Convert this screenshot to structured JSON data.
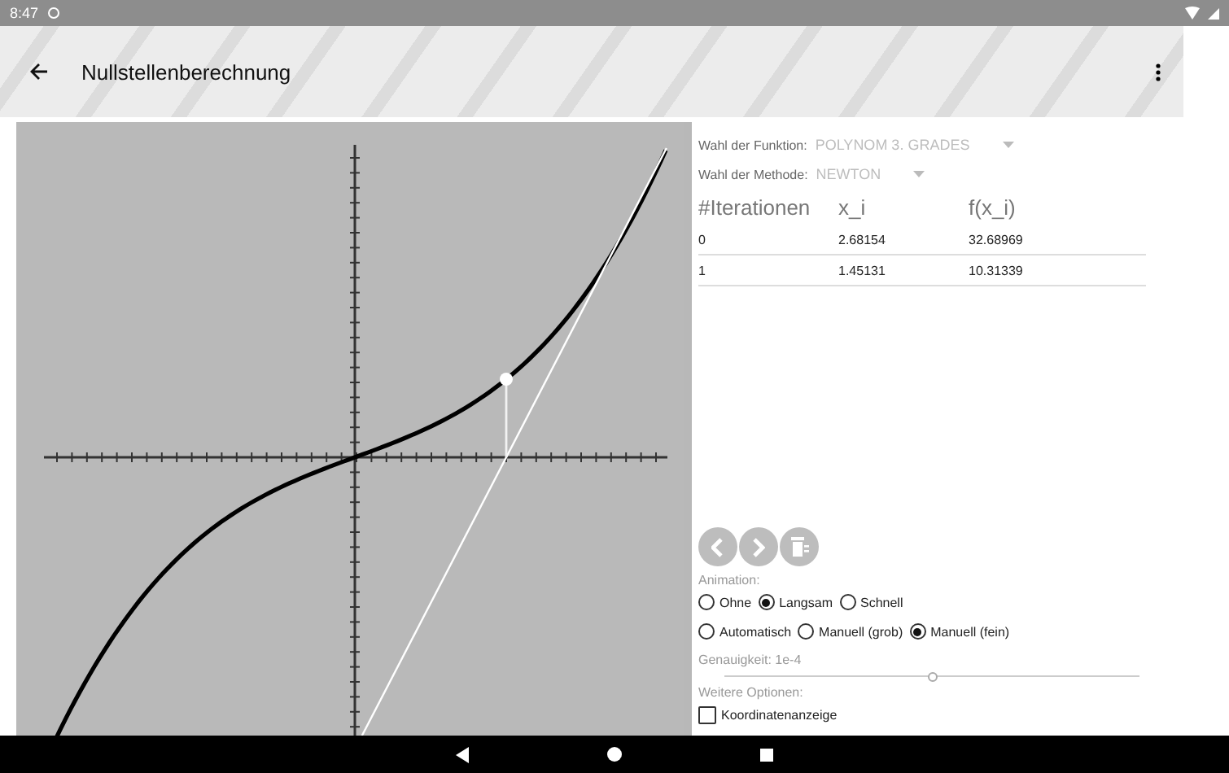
{
  "status_bar": {
    "time": "8:47"
  },
  "app_bar": {
    "title": "Nullstellenberechnung"
  },
  "settings": [
    {
      "label": "Wahl der Funktion:",
      "value": "POLYNOM 3. GRADES"
    },
    {
      "label": "Wahl der Methode:",
      "value": "NEWTON"
    }
  ],
  "table": {
    "columns": [
      "#Iterationen",
      "x_i",
      "f(x_i)"
    ],
    "rows": [
      [
        "0",
        "2.68154",
        "32.68969"
      ],
      [
        "1",
        "1.45131",
        "10.31339"
      ]
    ]
  },
  "step_buttons": [
    {
      "kind": "back"
    },
    {
      "kind": "forward"
    },
    {
      "kind": "delete"
    }
  ],
  "animation": {
    "label": "Animation:",
    "speed": [
      {
        "label": "Ohne",
        "selected": false
      },
      {
        "label": "Langsam",
        "selected": true
      },
      {
        "label": "Schnell",
        "selected": false
      }
    ],
    "mode": [
      {
        "label": "Automatisch",
        "selected": false
      },
      {
        "label": "Manuell (grob)",
        "selected": false
      },
      {
        "label": "Manuell (fein)",
        "selected": true
      }
    ]
  },
  "accuracy": {
    "label": "Genauigkeit: 1e-4",
    "level": 0.5
  },
  "options": {
    "label": "Weitere Optionen:",
    "items": [
      {
        "label": "Koordinatenanzeige",
        "checked": false
      }
    ]
  }
}
